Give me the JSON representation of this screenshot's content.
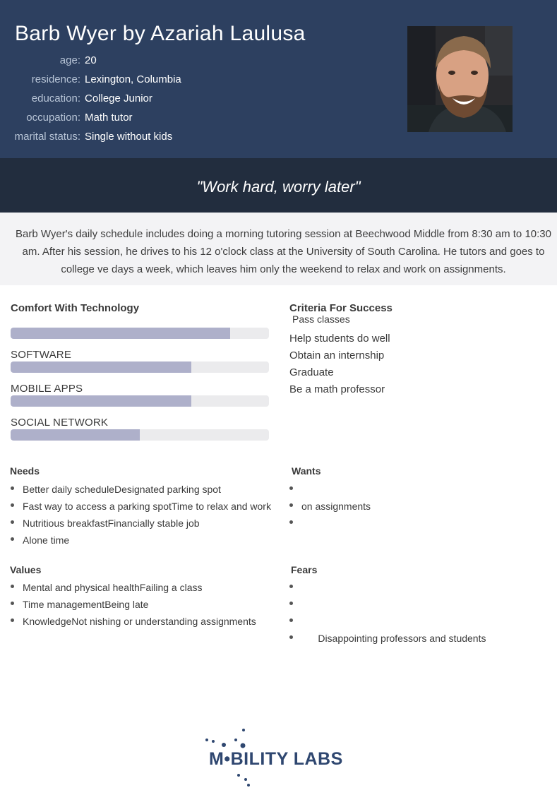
{
  "persona": {
    "name": "Barb Wyer by Azariah Laulusa",
    "facts": [
      {
        "label": "age:",
        "value": "20"
      },
      {
        "label": "residence:",
        "value": "Lexington, Columbia"
      },
      {
        "label": "education:",
        "value": "College Junior"
      },
      {
        "label": "occupation:",
        "value": "Math tutor"
      },
      {
        "label": "marital status:",
        "value": "Single without kids"
      }
    ]
  },
  "quote": "\"Work hard, worry later\"",
  "bio": "Barb Wyer's daily schedule includes doing a morning tutoring session at Beechwood Middle from 8:30 am to 10:30 am. After his session, he drives to his 12 o'clock class at the University of South Carolina. He tutors and goes to college    ve days a week, which leaves him only the weekend to relax and work on assignments.",
  "technology": {
    "title": "Comfort With Technology",
    "bars": [
      {
        "label": "",
        "level": 0.85
      },
      {
        "label": "SOFTWARE",
        "level": 0.7
      },
      {
        "label": "MOBILE APPS",
        "level": 0.7
      },
      {
        "label": "SOCIAL NETWORK",
        "level": 0.5
      }
    ]
  },
  "criteria": {
    "title": "Criteria For Success",
    "first": "Pass classes",
    "items": [
      "Help students do well",
      "Obtain an internship",
      "Graduate",
      "Be a math professor"
    ]
  },
  "needs": {
    "title": "Needs",
    "items": [
      "Better daily scheduleDesignated parking spot",
      "Fast way to access a parking spotTime to relax and work",
      "Nutritious breakfastFinancially stable job",
      "Alone time"
    ]
  },
  "wants": {
    "title": "Wants",
    "items": [
      "",
      "on assignments",
      ""
    ]
  },
  "values": {
    "title": "Values",
    "items": [
      "Mental and physical healthFailing a class",
      "Time managementBeing late",
      "KnowledgeNot nishing or understanding assignments"
    ]
  },
  "fears": {
    "title": "Fears",
    "items": [
      "",
      "",
      "",
      "      Disappointing professors and students"
    ]
  },
  "logo": {
    "text": "M•BILITY LABS",
    "color": "#2f4770"
  },
  "colors": {
    "header": "#2d4060",
    "quote_band": "#222d3e",
    "bar_fill": "#aeb0ca",
    "bar_track": "#ebebed"
  }
}
